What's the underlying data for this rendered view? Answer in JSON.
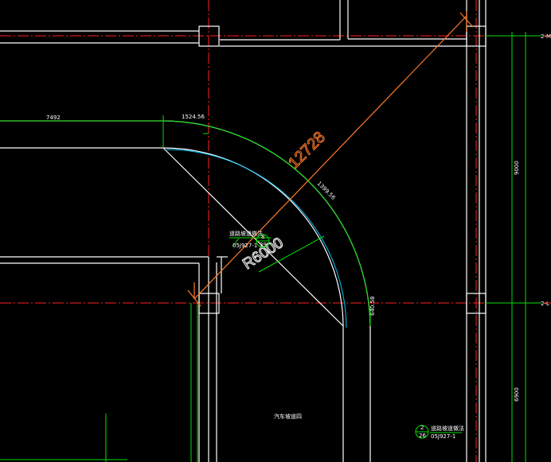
{
  "drawing": {
    "dimensions": {
      "d1": "7492",
      "d2": "1524.56",
      "d3": "1399.56",
      "d4": "640.58",
      "v1": "9000",
      "v2": "6900"
    },
    "leader_large": "12728",
    "radius_label": "R6000",
    "detail_ref_1": {
      "title": "道路坡道做法",
      "number": "8",
      "sheet": "39",
      "code": "05J927-1"
    },
    "detail_ref_2": {
      "title": "道路坡道做法",
      "number": "2",
      "sheet": "26",
      "code": "05J927-1"
    },
    "room_label": "汽车坡道四",
    "axis_labels": {
      "top": "2-M",
      "middle": "2-L"
    }
  },
  "colors": {
    "grid": "#ff2020",
    "walls": "#ffffff",
    "dimension": "#00e000",
    "leader": "#ff7a2a",
    "arc": "#00c8ff"
  }
}
